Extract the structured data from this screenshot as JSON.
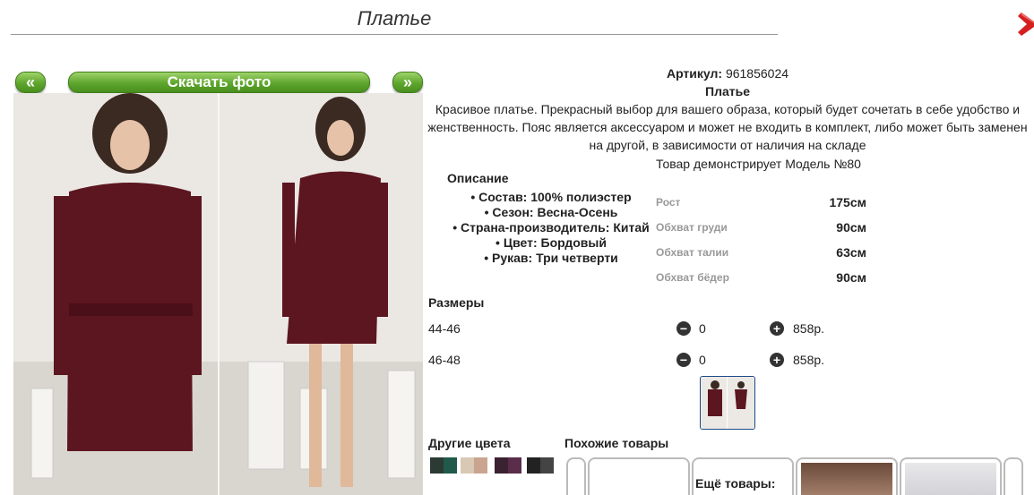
{
  "header": {
    "title": "Платье"
  },
  "gallery": {
    "prev_label": "«",
    "download_label": "Скачать фото",
    "next_label": "»"
  },
  "product": {
    "article_label": "Артикул:",
    "article_value": "961856024",
    "name": "Платье",
    "description": "Красивое платье. Прекрасный выбор для вашего образа, который будет сочетать в себе удобство и женственность. Пояс является аксессуаром и может не входить в комплект, либо может быть заменен на другой, в зависимости от наличия на складе",
    "model_note": "Товар демонстрирует Модель №80"
  },
  "details": {
    "heading": "Описание",
    "attributes": [
      "Состав: 100% полиэстер",
      "Сезон: Весна-Осень",
      "Страна-производитель: Китай",
      "Цвет: Бордовый",
      "Рукав: Три четверти"
    ]
  },
  "measurements": [
    {
      "label": "Рост",
      "value": "175см"
    },
    {
      "label": "Обхват груди",
      "value": "90см"
    },
    {
      "label": "Обхват талии",
      "value": "63см"
    },
    {
      "label": "Обхват бёдер",
      "value": "90см"
    }
  ],
  "sizes": {
    "heading": "Размеры",
    "rows": [
      {
        "size": "44-46",
        "qty": "0",
        "price": "858р."
      },
      {
        "size": "46-48",
        "qty": "0",
        "price": "858р."
      }
    ]
  },
  "sections": {
    "other_colors": "Другие цвета",
    "similar": "Похожие товары",
    "more": "Ещё товары:"
  },
  "colors": {
    "accent_green": "#5da52c",
    "dress": "#5c1620",
    "close_red": "#d42020"
  }
}
